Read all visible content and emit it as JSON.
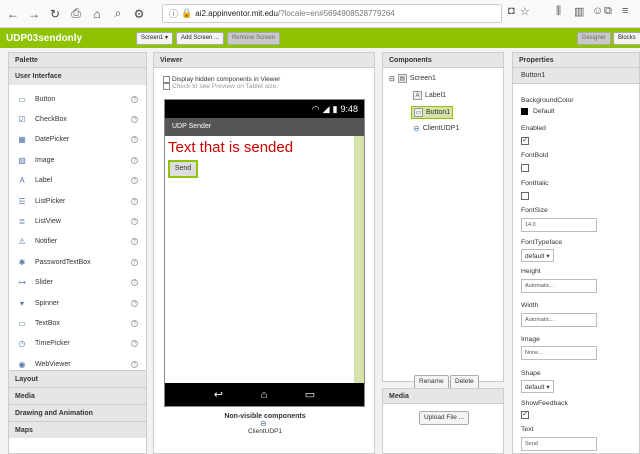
{
  "browser": {
    "url_domain": "ai2.appinventor.mit.edu",
    "url_rest": "/?locale=en#5694908528779264"
  },
  "appbar": {
    "project_name": "UDP03sendonly",
    "screen_select": "Screen1 ▾",
    "add_screen": "Add Screen ...",
    "remove_screen": "Remove Screen",
    "designer": "Designer",
    "blocks": "Blocks"
  },
  "palette": {
    "header": "Palette",
    "category_ui": "User Interface",
    "items": [
      "Button",
      "CheckBox",
      "DatePicker",
      "Image",
      "Label",
      "ListPicker",
      "ListView",
      "Notifier",
      "PasswordTextBox",
      "Slider",
      "Spinner",
      "TextBox",
      "TimePicker",
      "WebViewer"
    ],
    "categories": [
      "Layout",
      "Media",
      "Drawing and Animation",
      "Maps"
    ]
  },
  "viewer": {
    "header": "Viewer",
    "display_hidden": "Display hidden components in Viewer",
    "tablet_preview": "Check to see Preview on Tablet size.",
    "time": "9:48",
    "screen_title": "UDP Sender",
    "label_text": "Text that is sended",
    "button_text": "Send",
    "nonvisible_header": "Non-visible components",
    "nonvisible_item": "ClientUDP1"
  },
  "components": {
    "header": "Components",
    "screen": "Screen1",
    "label": "Label1",
    "button": "Button1",
    "client": "ClientUDP1",
    "rename": "Rename",
    "delete": "Delete"
  },
  "media": {
    "header": "Media",
    "upload": "Upload File ..."
  },
  "properties": {
    "header": "Properties",
    "component": "Button1",
    "bgcolor_label": "BackgroundColor",
    "bgcolor_value": "Default",
    "enabled_label": "Enabled",
    "fontbold_label": "FontBold",
    "fontitalic_label": "FontItalic",
    "fontsize_label": "FontSize",
    "fontsize_value": "14.0",
    "fonttypeface_label": "FontTypeface",
    "fonttypeface_value": "default ▾",
    "height_label": "Height",
    "height_value": "Automatic...",
    "width_label": "Width",
    "width_value": "Automatic...",
    "image_label": "Image",
    "image_value": "None...",
    "shape_label": "Shape",
    "shape_value": "default ▾",
    "showfeedback_label": "ShowFeedback",
    "text_label": "Text",
    "text_value": "Send"
  },
  "colors": {
    "accent": "#8fc202",
    "label_red": "#cc0000"
  }
}
